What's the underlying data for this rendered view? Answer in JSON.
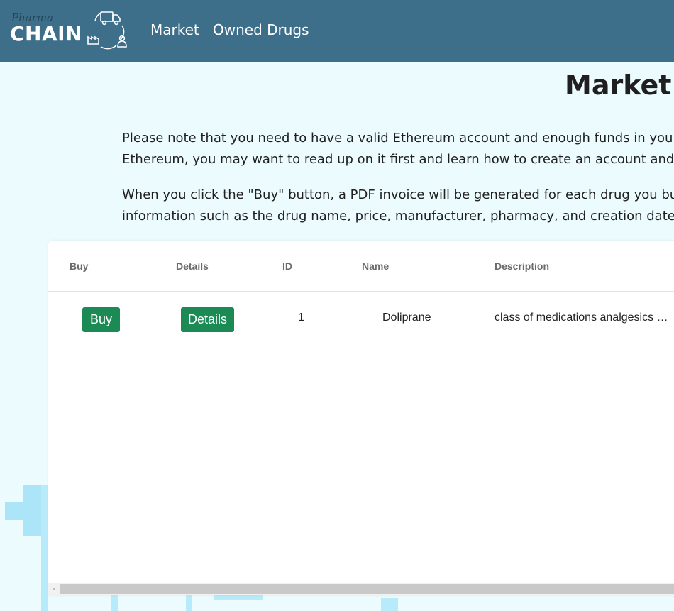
{
  "brand": {
    "script": "Pharma",
    "word": "CHAIN"
  },
  "nav": {
    "market": "Market",
    "owned": "Owned Drugs"
  },
  "page_title": "Market",
  "intro": {
    "p1_line1": "Please note that you need to have a valid Ethereum account and enough funds in your a",
    "p1_line2": "Ethereum, you may want to read up on it first and learn how to create an account and fu",
    "p2_line1": "When you click the \"Buy\" button, a PDF invoice will be generated for each drug you buy,",
    "p2_line2": "information such as the drug name, price, manufacturer, pharmacy, and creation date."
  },
  "table": {
    "headers": {
      "buy": "Buy",
      "details": "Details",
      "id": "ID",
      "name": "Name",
      "description": "Description"
    },
    "rows": [
      {
        "buy_label": "Buy",
        "details_label": "Details",
        "id": "1",
        "name": "Doliprane",
        "description": "class of medications analgesics …"
      }
    ]
  },
  "scrollbar": {
    "left_arrow": "‹"
  },
  "colors": {
    "navbar": "#3d6f8a",
    "page_bg": "#ecfbfe",
    "button_green": "#1b8a55",
    "deco": "#a9e4f7"
  },
  "icons": {
    "logo": "supply-chain-truck-factory-person-icon",
    "background": "medical-cross-icon"
  }
}
